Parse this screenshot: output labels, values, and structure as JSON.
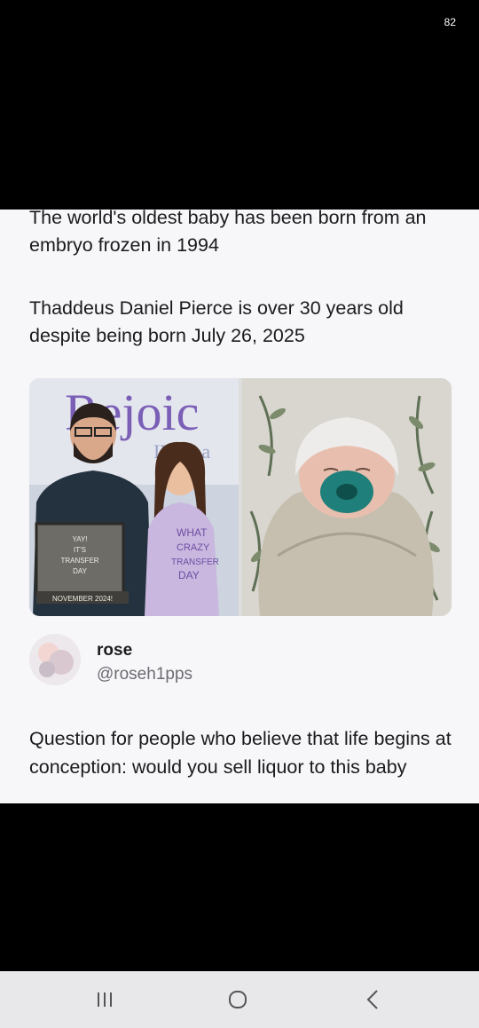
{
  "status_bar": {
    "battery": "82"
  },
  "post": {
    "headline": "The world's oldest baby has been born from an embryo frozen in 1994",
    "subhead": "Thaddeus Daniel Pierce is over 30 years old despite being born July 26, 2025",
    "photo_left": {
      "logo_text": "Rejoic",
      "logo_sub": "IVF La",
      "sign_lines": [
        "YAY!",
        "IT'S",
        "TRANSFER",
        "DAY"
      ],
      "sign_date": "NOVEMBER 2024!",
      "shirt_lines": [
        "WHAT",
        "CRAZY",
        "TRANSFER",
        "DAY"
      ]
    }
  },
  "reply": {
    "name": "rose",
    "handle": "@roseh1pps",
    "question": "Question for people who believe that life begins at conception: would you sell liquor to this baby"
  },
  "nav": {
    "recents_icon": "recents-icon",
    "home_icon": "home-icon",
    "back_icon": "back-icon"
  }
}
